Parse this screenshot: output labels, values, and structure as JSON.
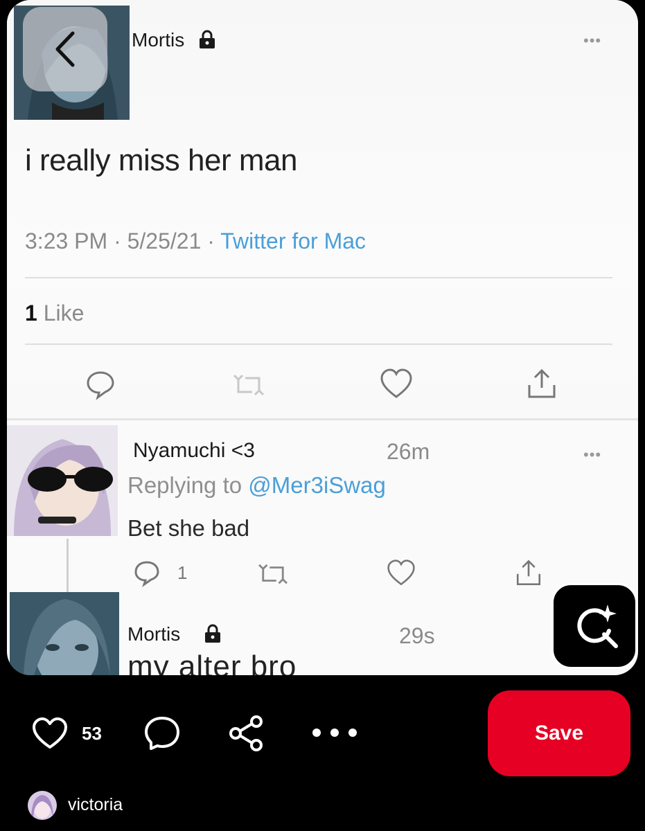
{
  "tweet": {
    "author": "Mortis",
    "text": "i really miss her man",
    "time": "3:23 PM",
    "date": "5/25/21",
    "source": "Twitter for Mac",
    "likes_count": "1",
    "likes_label": "Like"
  },
  "reply1": {
    "author": "Nyamuchi <3",
    "time": "26m",
    "replying_prefix": "Replying to",
    "replying_handle": "@Mer3iSwag",
    "text": "Bet she bad",
    "reply_count": "1"
  },
  "reply2": {
    "author": "Mortis",
    "time": "29s",
    "text": "my  alter  bro"
  },
  "pin_bar": {
    "like_count": "53",
    "save_label": "Save",
    "profile_name": "victoria"
  },
  "colors": {
    "save": "#e60023",
    "link": "#4a9fd8"
  },
  "icons": [
    "back-icon",
    "lock-icon",
    "more-icon",
    "reply-icon",
    "retweet-icon",
    "like-icon",
    "share-icon",
    "visual-search-icon",
    "heart-icon",
    "comment-icon",
    "share-network-icon",
    "dots-icon"
  ]
}
